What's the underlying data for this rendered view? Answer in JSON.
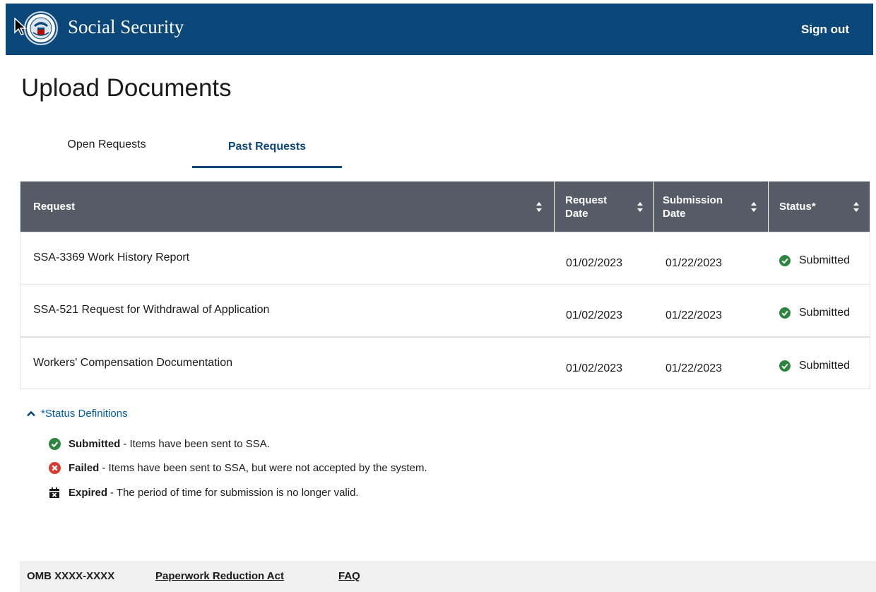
{
  "header": {
    "brand": "Social Security",
    "sign_out": "Sign out",
    "logo_icon": "ssa-seal-icon",
    "background": "#0b4778"
  },
  "page_title": "Upload Documents",
  "tabs": [
    {
      "label": "Open Requests",
      "active": false
    },
    {
      "label": "Past Requests",
      "active": true
    }
  ],
  "table": {
    "columns": [
      {
        "label": "Request"
      },
      {
        "label": "Request Date"
      },
      {
        "label": "Submission Date"
      },
      {
        "label": "Status*"
      }
    ],
    "rows": [
      {
        "request": "SSA-3369 Work History Report",
        "request_date": "01/02/2023",
        "submission_date": "01/22/2023",
        "status": "Submitted"
      },
      {
        "request": "SSA-521 Request for Withdrawal of Application",
        "request_date": "01/02/2023",
        "submission_date": "01/22/2023",
        "status": "Submitted"
      },
      {
        "request": "Workers' Compensation Documentation",
        "request_date": "01/02/2023",
        "submission_date": "01/22/2023",
        "status": "Submitted"
      }
    ]
  },
  "status_definitions": {
    "toggle_label": "*Status Definitions",
    "items": [
      {
        "term": "Submitted",
        "desc": "- Items have been sent to SSA.",
        "icon": "check-circle-icon",
        "color": "#2e8540"
      },
      {
        "term": "Failed",
        "desc": "- Items have been sent to SSA, but were not accepted by the system.",
        "icon": "x-circle-icon",
        "color": "#d83933"
      },
      {
        "term": "Expired",
        "desc": "- The period of time for submission is no longer valid.",
        "icon": "calendar-x-icon",
        "color": "#1b1b1b"
      }
    ]
  },
  "footer": {
    "omb": "OMB XXXX-XXXX",
    "links": [
      "Paperwork Reduction Act",
      "FAQ"
    ]
  },
  "colors": {
    "primary": "#0b4778",
    "link": "#005ea2",
    "table_header": "#565c65",
    "success": "#2e8540",
    "error": "#d83933"
  }
}
